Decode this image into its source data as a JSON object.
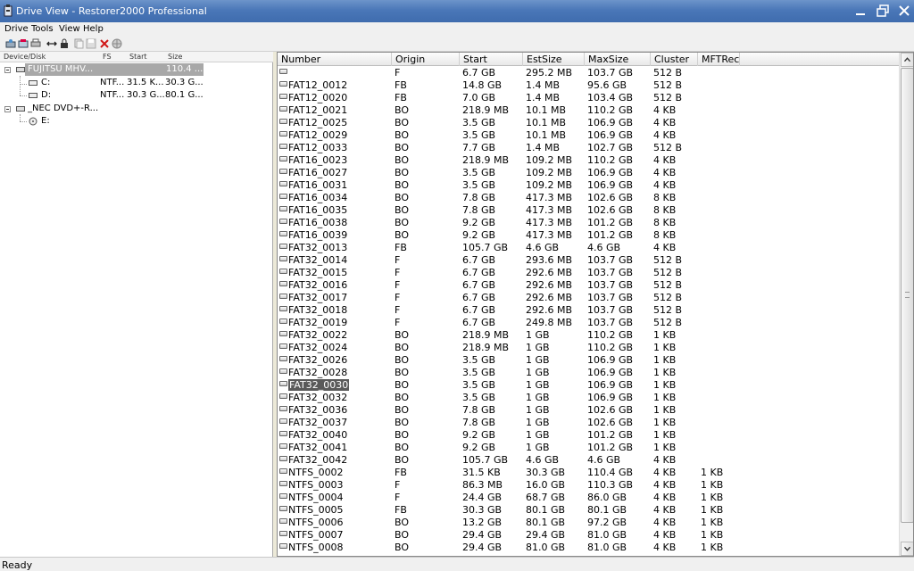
{
  "window": {
    "title": "Drive View - Restorer2000 Professional"
  },
  "menu": [
    "Drive",
    "Tools",
    "View",
    "Help"
  ],
  "toolbar": {
    "icons": [
      "open-drive-icon",
      "scan-icon",
      "print-icon",
      "connect-icon",
      "lock-icon",
      "copy-icon",
      "save-icon",
      "delete-icon",
      "globe-icon"
    ]
  },
  "tree": {
    "headers": {
      "device": "Device/Disk",
      "fs": "FS",
      "start": "Start",
      "size": "Size"
    },
    "items": [
      {
        "name": "FUJITSU MHV...",
        "fs": "",
        "start": "",
        "size": "110.4 ...",
        "selected": true
      },
      {
        "name": "C:",
        "fs": "NTF...",
        "start": "31.5 K...",
        "size": "30.3 G..."
      },
      {
        "name": "D:",
        "fs": "NTF...",
        "start": "30.3 G...",
        "size": "80.1 G..."
      },
      {
        "name": "_NEC DVD+-R...",
        "fs": "",
        "start": "",
        "size": ""
      },
      {
        "name": "E:",
        "fs": "",
        "start": "",
        "size": ""
      }
    ]
  },
  "list": {
    "columns": [
      "Number",
      "Origin",
      "Start",
      "EstSize",
      "MaxSize",
      "Cluster",
      "MFTRec"
    ],
    "rows": [
      [
        "",
        "F",
        "6.7 GB",
        "295.2 MB",
        "103.7 GB",
        "512 B",
        ""
      ],
      [
        "FAT12_0012",
        "FB",
        "14.8 GB",
        "1.4 MB",
        "95.6 GB",
        "512 B",
        ""
      ],
      [
        "FAT12_0020",
        "FB",
        "7.0 GB",
        "1.4 MB",
        "103.4 GB",
        "512 B",
        ""
      ],
      [
        "FAT12_0021",
        "BO",
        "218.9 MB",
        "10.1 MB",
        "110.2 GB",
        "4 KB",
        ""
      ],
      [
        "FAT12_0025",
        "BO",
        "3.5 GB",
        "10.1 MB",
        "106.9 GB",
        "4 KB",
        ""
      ],
      [
        "FAT12_0029",
        "BO",
        "3.5 GB",
        "10.1 MB",
        "106.9 GB",
        "4 KB",
        ""
      ],
      [
        "FAT12_0033",
        "BO",
        "7.7 GB",
        "1.4 MB",
        "102.7 GB",
        "512 B",
        ""
      ],
      [
        "FAT16_0023",
        "BO",
        "218.9 MB",
        "109.2 MB",
        "110.2 GB",
        "4 KB",
        ""
      ],
      [
        "FAT16_0027",
        "BO",
        "3.5 GB",
        "109.2 MB",
        "106.9 GB",
        "4 KB",
        ""
      ],
      [
        "FAT16_0031",
        "BO",
        "3.5 GB",
        "109.2 MB",
        "106.9 GB",
        "4 KB",
        ""
      ],
      [
        "FAT16_0034",
        "BO",
        "7.8 GB",
        "417.3 MB",
        "102.6 GB",
        "8 KB",
        ""
      ],
      [
        "FAT16_0035",
        "BO",
        "7.8 GB",
        "417.3 MB",
        "102.6 GB",
        "8 KB",
        ""
      ],
      [
        "FAT16_0038",
        "BO",
        "9.2 GB",
        "417.3 MB",
        "101.2 GB",
        "8 KB",
        ""
      ],
      [
        "FAT16_0039",
        "BO",
        "9.2 GB",
        "417.3 MB",
        "101.2 GB",
        "8 KB",
        ""
      ],
      [
        "FAT32_0013",
        "FB",
        "105.7 GB",
        "4.6 GB",
        "4.6 GB",
        "4 KB",
        ""
      ],
      [
        "FAT32_0014",
        "F",
        "6.7 GB",
        "293.6 MB",
        "103.7 GB",
        "512 B",
        ""
      ],
      [
        "FAT32_0015",
        "F",
        "6.7 GB",
        "292.6 MB",
        "103.7 GB",
        "512 B",
        ""
      ],
      [
        "FAT32_0016",
        "F",
        "6.7 GB",
        "292.6 MB",
        "103.7 GB",
        "512 B",
        ""
      ],
      [
        "FAT32_0017",
        "F",
        "6.7 GB",
        "292.6 MB",
        "103.7 GB",
        "512 B",
        ""
      ],
      [
        "FAT32_0018",
        "F",
        "6.7 GB",
        "292.6 MB",
        "103.7 GB",
        "512 B",
        ""
      ],
      [
        "FAT32_0019",
        "F",
        "6.7 GB",
        "249.8 MB",
        "103.7 GB",
        "512 B",
        ""
      ],
      [
        "FAT32_0022",
        "BO",
        "218.9 MB",
        "1 GB",
        "110.2 GB",
        "1 KB",
        ""
      ],
      [
        "FAT32_0024",
        "BO",
        "218.9 MB",
        "1 GB",
        "110.2 GB",
        "1 KB",
        ""
      ],
      [
        "FAT32_0026",
        "BO",
        "3.5 GB",
        "1 GB",
        "106.9 GB",
        "1 KB",
        ""
      ],
      [
        "FAT32_0028",
        "BO",
        "3.5 GB",
        "1 GB",
        "106.9 GB",
        "1 KB",
        ""
      ],
      [
        "FAT32_0030",
        "BO",
        "3.5 GB",
        "1 GB",
        "106.9 GB",
        "1 KB",
        ""
      ],
      [
        "FAT32_0032",
        "BO",
        "3.5 GB",
        "1 GB",
        "106.9 GB",
        "1 KB",
        ""
      ],
      [
        "FAT32_0036",
        "BO",
        "7.8 GB",
        "1 GB",
        "102.6 GB",
        "1 KB",
        ""
      ],
      [
        "FAT32_0037",
        "BO",
        "7.8 GB",
        "1 GB",
        "102.6 GB",
        "1 KB",
        ""
      ],
      [
        "FAT32_0040",
        "BO",
        "9.2 GB",
        "1 GB",
        "101.2 GB",
        "1 KB",
        ""
      ],
      [
        "FAT32_0041",
        "BO",
        "9.2 GB",
        "1 GB",
        "101.2 GB",
        "1 KB",
        ""
      ],
      [
        "FAT32_0042",
        "BO",
        "105.7 GB",
        "4.6 GB",
        "4.6 GB",
        "4 KB",
        ""
      ],
      [
        "NTFS_0002",
        "FB",
        "31.5 KB",
        "30.3 GB",
        "110.4 GB",
        "4 KB",
        "1 KB"
      ],
      [
        "NTFS_0003",
        "F",
        "86.3 MB",
        "16.0 GB",
        "110.3 GB",
        "4 KB",
        "1 KB"
      ],
      [
        "NTFS_0004",
        "F",
        "24.4 GB",
        "68.7 GB",
        "86.0 GB",
        "4 KB",
        "1 KB"
      ],
      [
        "NTFS_0005",
        "FB",
        "30.3 GB",
        "80.1 GB",
        "80.1 GB",
        "4 KB",
        "1 KB"
      ],
      [
        "NTFS_0006",
        "BO",
        "13.2 GB",
        "80.1 GB",
        "97.2 GB",
        "4 KB",
        "1 KB"
      ],
      [
        "NTFS_0007",
        "BO",
        "29.4 GB",
        "29.4 GB",
        "81.0 GB",
        "4 KB",
        "1 KB"
      ],
      [
        "NTFS_0008",
        "BO",
        "29.4 GB",
        "81.0 GB",
        "81.0 GB",
        "4 KB",
        "1 KB"
      ]
    ],
    "selected_row": "FAT32_0030"
  },
  "status": {
    "text": "Ready"
  }
}
